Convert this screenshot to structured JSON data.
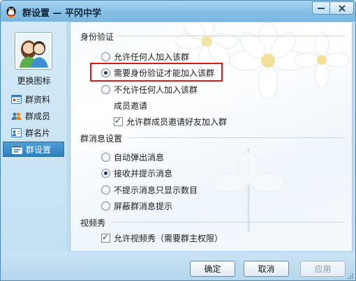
{
  "window": {
    "title": "群设置 — 平冈中学",
    "accent_color": "#2d7fc0",
    "title_icon": "penguin-icon"
  },
  "left_panel": {
    "change_icon_label": "更换图标",
    "nav_items": [
      {
        "label": "群资料",
        "icon": "profile-card-icon",
        "active": false
      },
      {
        "label": "群成员",
        "icon": "members-icon",
        "active": false
      },
      {
        "label": "群名片",
        "icon": "name-card-icon",
        "active": false
      },
      {
        "label": "群设置",
        "icon": "settings-card-icon",
        "active": true
      }
    ]
  },
  "identity": {
    "title": "身份验证",
    "options": [
      {
        "label": "允许任何人加入该群",
        "checked": false
      },
      {
        "label": "需要身份验证才能加入该群",
        "checked": true
      },
      {
        "label": "不允许任何人加入该群",
        "checked": false
      }
    ],
    "member_invite_title": "成员邀请",
    "member_invite_option": {
      "label": "允许群成员邀请好友加入群",
      "checked": true
    }
  },
  "messages": {
    "title": "群消息设置",
    "options": [
      {
        "label": "自动弹出消息",
        "checked": false
      },
      {
        "label": "接收并提示消息",
        "checked": true
      },
      {
        "label": "不提示消息只显示数目",
        "checked": false
      },
      {
        "label": "屏蔽群消息提示",
        "checked": false
      }
    ]
  },
  "video": {
    "title": "视频秀",
    "option": {
      "label": "允许视频秀（需要群主权限）",
      "checked": true
    }
  },
  "footer": {
    "ok_label": "确定",
    "cancel_label": "取消",
    "apply_label": "应用"
  },
  "highlight_color": "#d61a1a"
}
